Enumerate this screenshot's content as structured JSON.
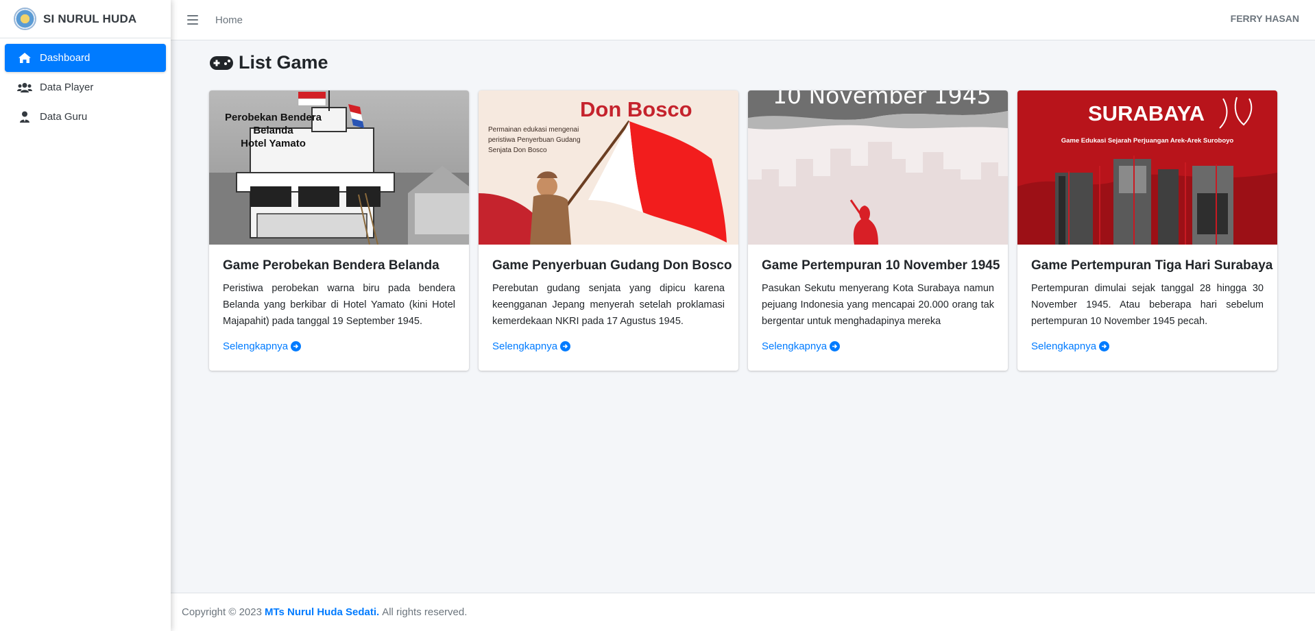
{
  "brand": {
    "name": "SI NURUL HUDA"
  },
  "sidebar": {
    "items": [
      {
        "label": "Dashboard",
        "icon": "home-icon",
        "active": true
      },
      {
        "label": "Data Player",
        "icon": "users-icon",
        "active": false
      },
      {
        "label": "Data Guru",
        "icon": "user-tie-icon",
        "active": false
      }
    ]
  },
  "topbar": {
    "menu_icon": "hamburger-icon",
    "home_label": "Home",
    "user_name": "FERRY HASAN"
  },
  "main": {
    "title": "List Game",
    "title_icon": "gamepad-icon",
    "cards": [
      {
        "title": "Game Perobekan Bendera Belanda",
        "text": "Peristiwa perobekan warna biru pada bendera Belanda yang berkibar di Hotel Yamato (kini Hotel Majapahit) pada tanggal 19 September 1945.",
        "link": "Selengkapnya",
        "image_text": [
          "Perobekan Bendera Belanda",
          "Hotel Yamato"
        ]
      },
      {
        "title": "Game Penyerbuan Gudang Don Bosco",
        "text": "Perebutan gudang senjata yang dipicu karena keengganan Jepang menyerah setelah proklamasi kemerdekaan NKRI pada 17 Agustus 1945.",
        "link": "Selengkapnya",
        "image_text": [
          "Don Bosco",
          "Permainan edukasi mengenai peristiwa Penyerbuan Gudang Senjata Don Bosco"
        ]
      },
      {
        "title": "Game Pertempuran 10 November 1945",
        "text": "Pasukan Sekutu menyerang Kota Surabaya namun pejuang Indonesia yang mencapai 20.000 orang tak bergentar untuk menghadapinya mereka",
        "link": "Selengkapnya",
        "image_text": [
          "10 November 1945"
        ]
      },
      {
        "title": "Game Pertempuran Tiga Hari Surabaya",
        "text": "Pertempuran dimulai sejak tanggal 28 hingga 30 November 1945. Atau beberapa hari sebelum pertempuran 10 November 1945 pecah.",
        "link": "Selengkapnya",
        "image_text": [
          "SURABAYA",
          "Game Edukasi Sejarah Perjuangan Arek-Arek Suroboyo"
        ]
      }
    ]
  },
  "footer": {
    "prefix": "Copyright © 2023",
    "org": "MTs Nurul Huda Sedati.",
    "suffix": "All rights reserved."
  },
  "colors": {
    "primary": "#007bff",
    "sidebar_bg": "#ffffff",
    "content_bg": "#f4f6f9"
  }
}
